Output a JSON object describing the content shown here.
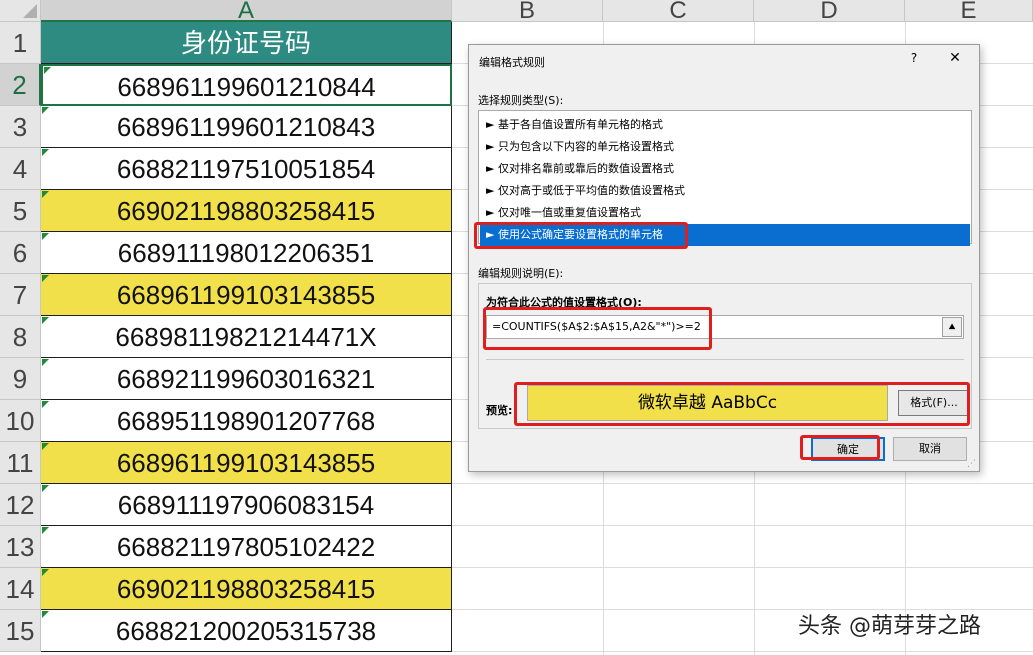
{
  "spreadsheet": {
    "columns": [
      "A",
      "B",
      "C",
      "D",
      "E"
    ],
    "row_numbers": [
      "1",
      "2",
      "3",
      "4",
      "5",
      "6",
      "7",
      "8",
      "9",
      "10",
      "11",
      "12",
      "13",
      "14",
      "15"
    ],
    "header_cell": "身份证号码",
    "id_numbers": [
      "668961199601210844",
      "668961199601210843",
      "668821197510051854",
      "669021198803258415",
      "668911198012206351",
      "668961199103143855",
      "66898119821214471X",
      "668921199603016321",
      "668951198901207768",
      "668961199103143855",
      "668911197906083154",
      "668821197805102422",
      "669021198803258415",
      "668821200205315738"
    ],
    "highlighted_rows": [
      5,
      7,
      11,
      14
    ],
    "active_cell": "A2",
    "colors": {
      "header_fill": "#2e8b82",
      "highlight_fill": "#f2e04a"
    }
  },
  "dialog": {
    "title": "编辑格式规则",
    "help": "?",
    "close": "✕",
    "rule_type_label": "选择规则类型(S):",
    "rule_types": [
      "► 基于各自值设置所有单元格的格式",
      "► 只为包含以下内容的单元格设置格式",
      "► 仅对排名靠前或靠后的数值设置格式",
      "► 仅对高于或低于平均值的数值设置格式",
      "► 仅对唯一值或重复值设置格式",
      "► 使用公式确定要设置格式的单元格"
    ],
    "selected_rule_index": 5,
    "description_label": "编辑规则说明(E):",
    "formula_label": "为符合此公式的值设置格式(O):",
    "formula": "=COUNTIFS($A$2:$A$15,A2&\"*\")>=2",
    "collapse_icon": "⯅",
    "preview_label": "预览:",
    "preview_text": "微软卓越  AaBbCc",
    "format_button": "格式(F)...",
    "ok_button": "确定",
    "cancel_button": "取消",
    "colors": {
      "selection": "#0a6ed1",
      "annotation_red": "#e01e1e"
    }
  },
  "watermark": "头条 @萌芽芽之路"
}
